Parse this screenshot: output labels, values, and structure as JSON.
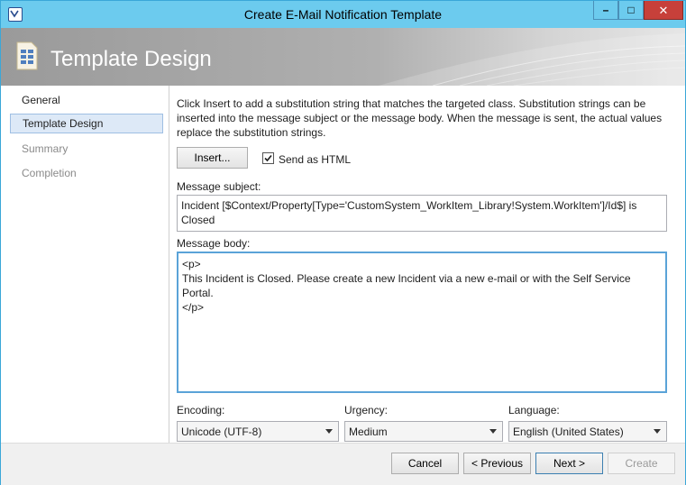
{
  "window": {
    "title": "Create E-Mail Notification Template",
    "controls": {
      "minimize": "–",
      "maximize": "□",
      "close": "✕"
    }
  },
  "banner": {
    "title": "Template Design",
    "icon": "template-design-icon"
  },
  "sidebar": {
    "items": [
      {
        "label": "General",
        "state": "normal"
      },
      {
        "label": "Template Design",
        "state": "selected"
      },
      {
        "label": "Summary",
        "state": "disabled"
      },
      {
        "label": "Completion",
        "state": "disabled"
      }
    ]
  },
  "content": {
    "intro": "Click Insert to add a substitution string that matches the targeted class. Substitution strings can be inserted into the message subject or the message body. When the message is sent, the actual values replace the substitution strings.",
    "insert_label": "Insert...",
    "send_as_html": {
      "label": "Send as HTML",
      "checked": true
    },
    "subject": {
      "label": "Message subject:",
      "value": "Incident [$Context/Property[Type='CustomSystem_WorkItem_Library!System.WorkItem']/Id$] is Closed"
    },
    "body": {
      "label": "Message body:",
      "lines": [
        "<p>",
        "This Incident is Closed. Please create a new Incident via a new e-mail or with the Self Service Portal.",
        "</p>"
      ]
    },
    "encoding": {
      "label": "Encoding:",
      "value": "Unicode (UTF-8)"
    },
    "urgency": {
      "label": "Urgency:",
      "value": "Medium"
    },
    "language": {
      "label": "Language:",
      "value": "English (United States)"
    }
  },
  "footer": {
    "cancel": "Cancel",
    "previous": "< Previous",
    "next": "Next >",
    "create": "Create"
  },
  "colors": {
    "titlebar": "#6ccbee",
    "close_button": "#c7403a",
    "selection": "#dde9f7",
    "focus_border": "#5aa3d8"
  }
}
